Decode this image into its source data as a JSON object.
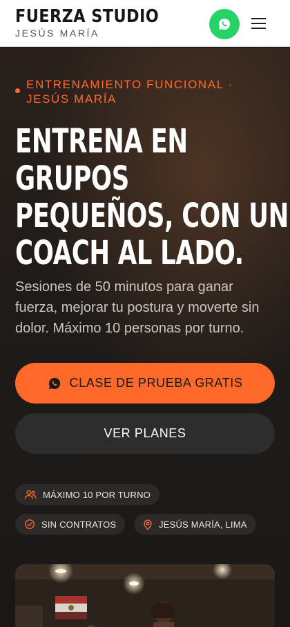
{
  "header": {
    "brand_name": "FUERZA STUDIO",
    "brand_location": "JESÚS MARÍA",
    "whatsapp_color": "#25d366"
  },
  "hero": {
    "eyebrow": "ENTRENAMIENTO FUNCIONAL · JESÚS MARÍA",
    "headline_lines": [
      "ENTRENA EN",
      "GRUPOS",
      "PEQUEÑOS, CON UN",
      "COACH AL LADO."
    ],
    "lead": "Sesiones de 50 minutos para ganar fuerza, mejorar tu postura y moverte sin dolor. Máximo 10 personas por turno.",
    "primary_cta": "CLASE DE PRUEBA GRATIS",
    "secondary_cta": "VER PLANES",
    "accent_color": "#ff6a2a"
  },
  "badges": {
    "max_per_shift": "MÁXIMO 10 POR TURNO",
    "no_contracts": "SIN CONTRATOS",
    "location": "JESÚS MARÍA, LIMA"
  },
  "icons": {
    "whatsapp": "whatsapp-icon",
    "menu": "menu-icon",
    "users": "users-icon",
    "check": "check-circle-icon",
    "pin": "map-pin-icon"
  }
}
